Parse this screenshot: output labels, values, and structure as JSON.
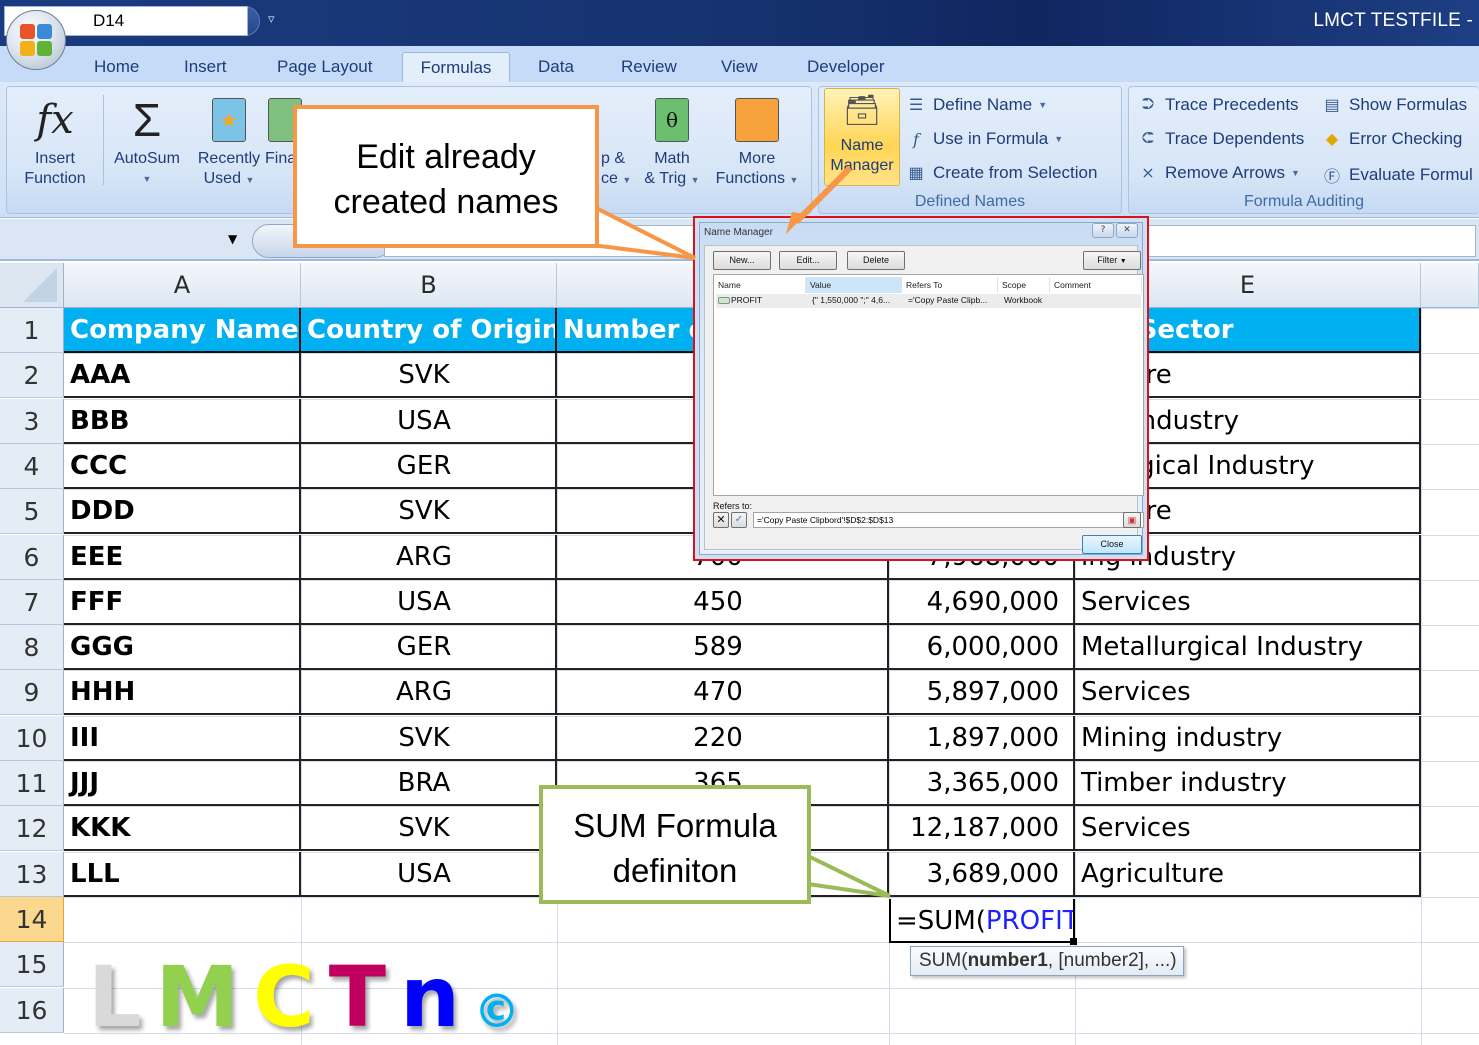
{
  "window": {
    "title": "LMCT TESTFILE -",
    "qat_icons": [
      "save-icon",
      "undo-icon",
      "redo-icon",
      "table-icon"
    ]
  },
  "ribbon_tabs": [
    {
      "label": "Home",
      "active": false
    },
    {
      "label": "Insert",
      "active": false
    },
    {
      "label": "Page Layout",
      "active": false
    },
    {
      "label": "Formulas",
      "active": true
    },
    {
      "label": "Data",
      "active": false
    },
    {
      "label": "Review",
      "active": false
    },
    {
      "label": "View",
      "active": false
    },
    {
      "label": "Developer",
      "active": false
    }
  ],
  "ribbon": {
    "function_library": {
      "insert_function": {
        "line1": "Insert",
        "line2": "Function",
        "icon": "fx"
      },
      "autosum": {
        "line1": "AutoSum",
        "icon": "Σ"
      },
      "recently_used": {
        "line1": "Recently",
        "line2": "Used"
      },
      "financial": {
        "line1": "Fina"
      },
      "lookup_reference": {
        "line1": "p &",
        "line2": "ce"
      },
      "math_trig": {
        "line1": "Math",
        "line2": "& Trig",
        "icon": "θ"
      },
      "more_functions": {
        "line1": "More",
        "line2": "Functions"
      }
    },
    "defined_names": {
      "label": "Defined Names",
      "name_manager": {
        "line1": "Name",
        "line2": "Manager"
      },
      "define_name": "Define Name",
      "use_in_formula": "Use in Formula",
      "create_from_selection": "Create from Selection"
    },
    "formula_auditing": {
      "label": "Formula Auditing",
      "trace_precedents": "Trace Precedents",
      "trace_dependents": "Trace Dependents",
      "remove_arrows": "Remove Arrows",
      "show_formulas": "Show Formulas",
      "error_checking": "Error Checking",
      "evaluate_formula": "Evaluate Formul"
    }
  },
  "formula_bar": {
    "name_box": "D14",
    "formula": ""
  },
  "sheet": {
    "columns": [
      "A",
      "B",
      "",
      "",
      "E"
    ],
    "header_row": [
      "Company Name",
      "Country of Origin",
      "Number o",
      "",
      "ess Sector"
    ],
    "row_numbers": [
      "1",
      "2",
      "3",
      "4",
      "5",
      "6",
      "7",
      "8",
      "9",
      "10",
      "11",
      "12",
      "13",
      "14",
      "15",
      "16"
    ],
    "rows": [
      {
        "a": "AAA",
        "b": "SVK",
        "c": "",
        "d": "",
        "e": "culture"
      },
      {
        "a": "BBB",
        "b": "USA",
        "c": "",
        "d": "",
        "e": "ber industry"
      },
      {
        "a": "CCC",
        "b": "GER",
        "c": "",
        "d": "",
        "e": "allurgical Industry"
      },
      {
        "a": "DDD",
        "b": "SVK",
        "c": "",
        "d": "",
        "e": "culture"
      },
      {
        "a": "EEE",
        "b": "ARG",
        "c": "700",
        "d": "7,968,000",
        "e": "ing industry"
      },
      {
        "a": "FFF",
        "b": "USA",
        "c": "450",
        "d": "4,690,000",
        "e": "Services"
      },
      {
        "a": "GGG",
        "b": "GER",
        "c": "589",
        "d": "6,000,000",
        "e": "Metallurgical Industry"
      },
      {
        "a": "HHH",
        "b": "ARG",
        "c": "470",
        "d": "5,897,000",
        "e": "Services"
      },
      {
        "a": "III",
        "b": "SVK",
        "c": "220",
        "d": "1,897,000",
        "e": "Mining industry"
      },
      {
        "a": "JJJ",
        "b": "BRA",
        "c": "365",
        "d": "3,365,000",
        "e": "Timber industry"
      },
      {
        "a": "KKK",
        "b": "SVK",
        "c": "",
        "d": "12,187,000",
        "e": "Services"
      },
      {
        "a": "LLL",
        "b": "USA",
        "c": "",
        "d": "3,689,000",
        "e": "Agriculture"
      }
    ],
    "active_cell": {
      "ref": "D14",
      "formula_prefix": "=SUM(",
      "formula_arg": "PROFIT",
      "formula_suffix": ")"
    },
    "tooltip": {
      "fn": "SUM(",
      "arg1": "number1",
      "rest": ", [number2], ...)"
    },
    "colors": {
      "header_fill": "#00b0f0",
      "header_text": "#ffffff",
      "selected_row_header": "#fcd88f",
      "formula_arg": "#1f1fff"
    }
  },
  "name_manager_dialog": {
    "title": "Name Manager",
    "buttons": {
      "new": "New...",
      "edit": "Edit...",
      "delete": "Delete",
      "filter": "Filter",
      "close": "Close"
    },
    "columns": [
      "Name",
      "Value",
      "Refers To",
      "Scope",
      "Comment"
    ],
    "entries": [
      {
        "name": "PROFIT",
        "value": "{\" 1,550,000 \";\" 4,6...",
        "refers_to": "='Copy Paste Clipb...",
        "scope": "Workbook",
        "comment": ""
      }
    ],
    "refers_to_label": "Refers to:",
    "refers_to_value": "='Copy Paste Clipbord'!$D$2:$D$13"
  },
  "callouts": {
    "edit_names": {
      "line1": "Edit already",
      "line2": "created names",
      "border": "#f79646"
    },
    "sum_formula": {
      "line1": "SUM Formula",
      "line2": "definiton",
      "border": "#9bbb59"
    }
  },
  "watermark": {
    "letters": [
      {
        "ch": "L",
        "color": "#d9d9d9"
      },
      {
        "ch": "M",
        "color": "#92d050"
      },
      {
        "ch": "C",
        "color": "#ffff00"
      },
      {
        "ch": "T",
        "color": "#c00060"
      },
      {
        "ch": "n",
        "color": "#0000ff"
      },
      {
        "ch": "©",
        "color": "#00b0f0"
      }
    ]
  }
}
